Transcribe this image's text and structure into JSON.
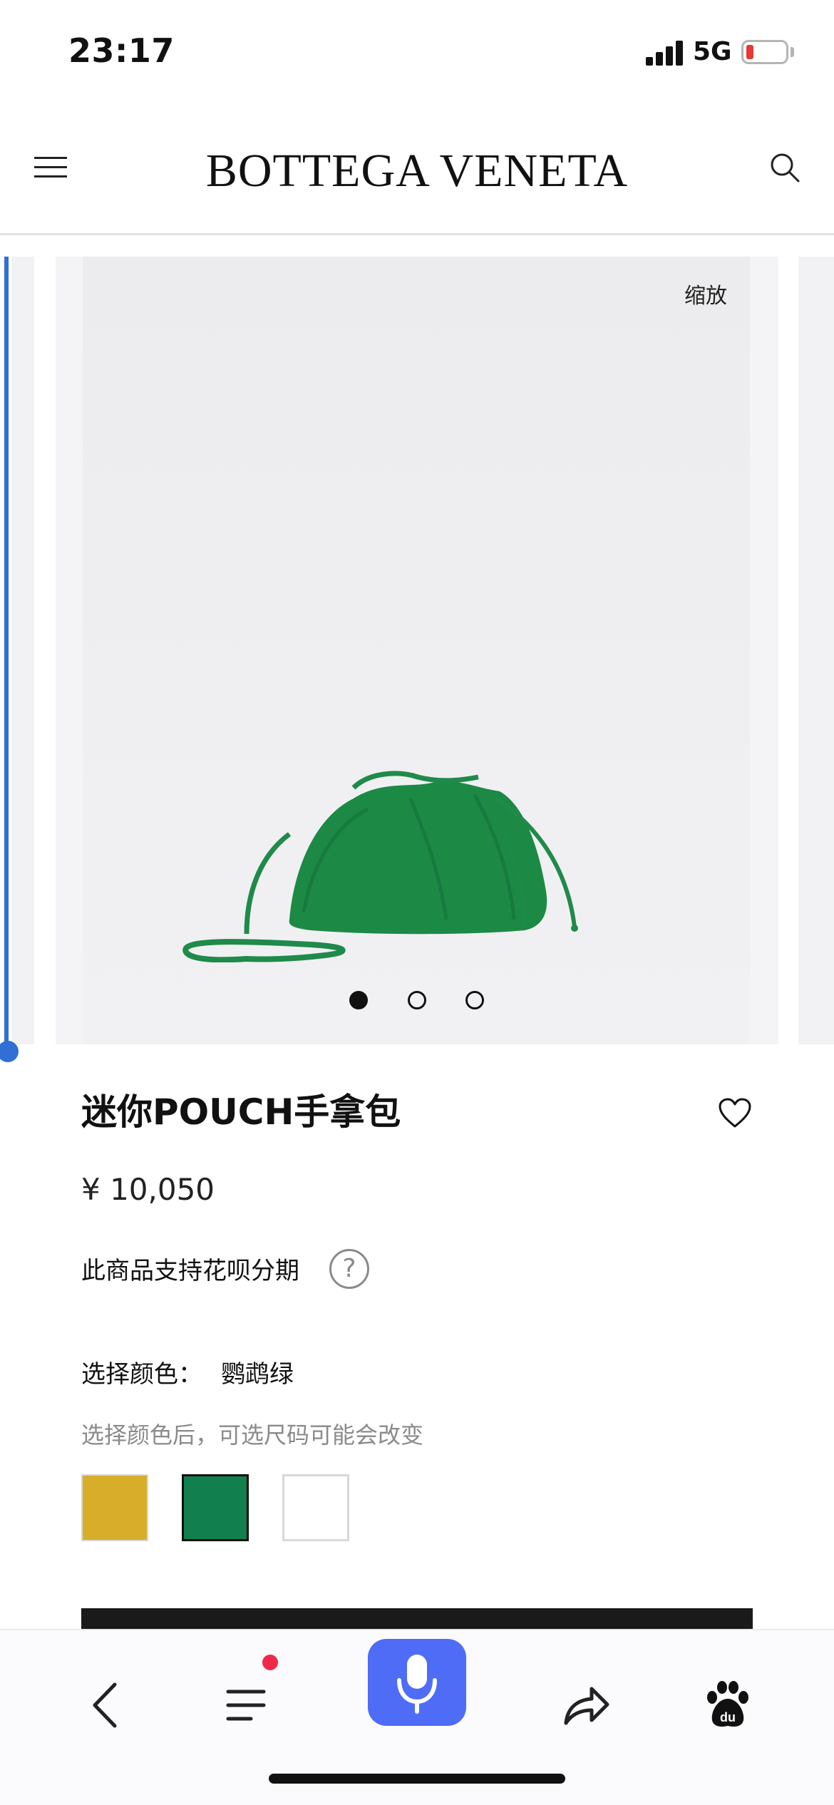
{
  "status_bar": {
    "time": "23:17",
    "network": "5G",
    "battery_level": 0.12,
    "icons": [
      "signal-icon",
      "battery-icon"
    ]
  },
  "header": {
    "brand": "BOTTEGA VENETA",
    "menu_icon": "menu-icon",
    "search_icon": "search-icon"
  },
  "gallery": {
    "zoom_label": "缩放",
    "image_alt_subject": "green knitted pouch bag",
    "active_index": 0,
    "total_images": 3
  },
  "product": {
    "title": "迷你POUCH手拿包",
    "price": "¥ 10,050",
    "installment_text": "此商品支持花呗分期",
    "help_symbol": "?",
    "color_label": "选择颜色：",
    "color_value": "鹦鹉绿",
    "color_hint": "选择颜色后，可选尺码可能会改变",
    "swatches": [
      {
        "name": "yellow",
        "color": "#d7ad2a",
        "selected": false
      },
      {
        "name": "parakeet-green",
        "color": "#117f4e",
        "selected": true
      },
      {
        "name": "white",
        "color": "#ffffff",
        "selected": false
      }
    ]
  },
  "toolbar": {
    "items": [
      "back-icon",
      "menu-icon",
      "voice-icon",
      "share-icon",
      "baidu-icon"
    ],
    "accent_color": "#4e6cf6",
    "notification_color": "#f0294a"
  }
}
